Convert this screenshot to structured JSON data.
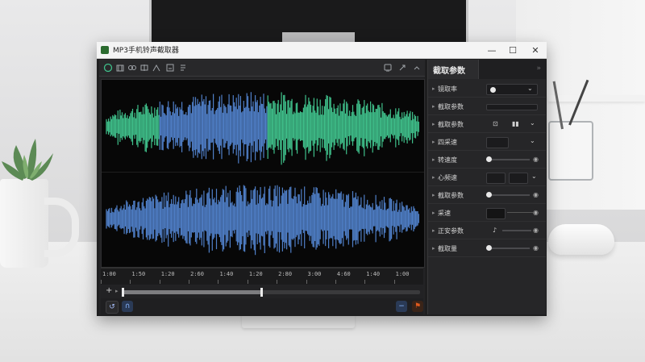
{
  "window": {
    "title": "MP3手机铃声截取器",
    "minimize_symbol": "—",
    "maximize_symbol": "☐",
    "close_symbol": "✕"
  },
  "toolbar": {
    "icons": [
      "waveform-icon",
      "cut-icon",
      "merge-icon",
      "split-icon",
      "fade-icon",
      "export-icon",
      "list-icon"
    ],
    "right_icons": [
      "settings-icon",
      "pin-icon",
      "collapse-icon"
    ]
  },
  "timeline": {
    "ticks": [
      "1:00",
      "1:50",
      "1:20",
      "2:60",
      "1:40",
      "1:20",
      "2:80",
      "3:00",
      "4:60",
      "1:40",
      "1:00"
    ]
  },
  "playback": {
    "add_symbol": "+",
    "progress": 0.47,
    "start_marker": 0.0
  },
  "panel": {
    "title": "截取参数",
    "close_symbol": "»",
    "rows": [
      {
        "label": "镜取率",
        "control": "slider-dropdown"
      },
      {
        "label": "截取参数",
        "control": "bar"
      },
      {
        "label": "截取参数",
        "control": "icons-dropdown"
      },
      {
        "label": "四采速",
        "control": "box-dropdown"
      },
      {
        "label": "转速度",
        "control": "slider-dot"
      },
      {
        "label": "心频速",
        "control": "icons-dropdown2"
      },
      {
        "label": "截取参数",
        "control": "slider-dot2"
      },
      {
        "label": "采速",
        "control": "box-line"
      },
      {
        "label": "正安参数",
        "control": "icon-slider"
      },
      {
        "label": "截取量",
        "control": "slider-dot3"
      }
    ]
  },
  "colors": {
    "waveform_top": "#3fbf8a",
    "waveform_top_selected": "#4f7fc7",
    "waveform_bottom": "#4f7fc7",
    "background": "#070707",
    "accent_orange": "#e05a1e",
    "accent_blue": "#3b82c4"
  }
}
